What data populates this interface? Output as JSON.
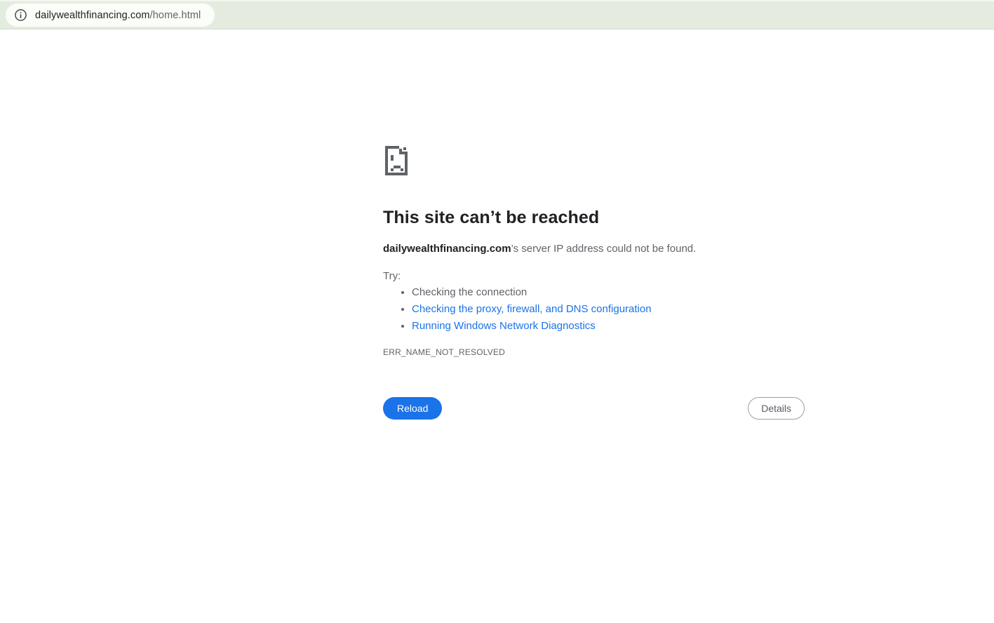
{
  "browser": {
    "toolbar": {
      "bg_color": "#e4ecdf",
      "pill_bg": "#fbfdf8",
      "info_icon": "info-circle-icon",
      "url_domain": "dailywealthfinancing.com",
      "url_path": "/home.html"
    }
  },
  "error_page": {
    "icon": "sad-file-icon",
    "title": "This site can’t be reached",
    "message_domain": "dailywealthfinancing.com",
    "message_suffix": "’s server IP address could not be found.",
    "try_label": "Try:",
    "suggestions": [
      {
        "label": "Checking the connection",
        "is_link": false
      },
      {
        "label": "Checking the proxy, firewall, and DNS configuration",
        "is_link": true
      },
      {
        "label": "Running Windows Network Diagnostics",
        "is_link": true
      }
    ],
    "error_code": "ERR_NAME_NOT_RESOLVED",
    "reload_button": "Reload",
    "details_button": "Details",
    "colors": {
      "link": "#1a73e8",
      "primary_button_bg": "#1a73e8",
      "body_gray": "#5f6368",
      "heading": "#202124"
    }
  }
}
